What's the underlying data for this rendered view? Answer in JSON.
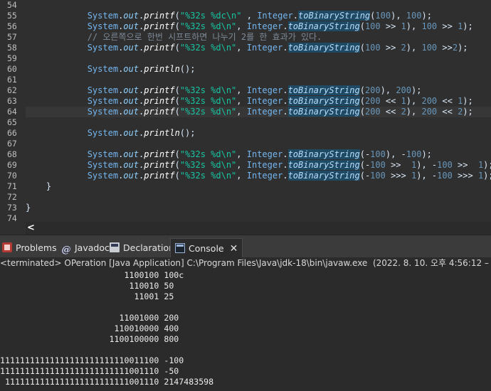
{
  "editor": {
    "current_line": 64,
    "lines": [
      {
        "num": "54",
        "tokens": []
      },
      {
        "num": "55",
        "tokens": [
          {
            "t": "System",
            "c": "cls"
          },
          {
            "t": ".",
            "c": "pln"
          },
          {
            "t": "out",
            "c": "fld"
          },
          {
            "t": ".",
            "c": "pln"
          },
          {
            "t": "printf",
            "c": "mth"
          },
          {
            "t": "(",
            "c": "pln"
          },
          {
            "t": "\"%32s %dc\\n\"",
            "c": "str"
          },
          {
            "t": " , ",
            "c": "pln"
          },
          {
            "t": "Integer",
            "c": "cls"
          },
          {
            "t": ".",
            "c": "pln"
          },
          {
            "t": "toBinaryString",
            "c": "hl"
          },
          {
            "t": "(",
            "c": "pln"
          },
          {
            "t": "100",
            "c": "num"
          },
          {
            "t": "), ",
            "c": "pln"
          },
          {
            "t": "100",
            "c": "num"
          },
          {
            "t": ");",
            "c": "pln"
          }
        ]
      },
      {
        "num": "56",
        "tokens": [
          {
            "t": "System",
            "c": "cls"
          },
          {
            "t": ".",
            "c": "pln"
          },
          {
            "t": "out",
            "c": "fld"
          },
          {
            "t": ".",
            "c": "pln"
          },
          {
            "t": "printf",
            "c": "mth"
          },
          {
            "t": "(",
            "c": "pln"
          },
          {
            "t": "\"%32s %d\\n\"",
            "c": "str"
          },
          {
            "t": ", ",
            "c": "pln"
          },
          {
            "t": "Integer",
            "c": "cls"
          },
          {
            "t": ".",
            "c": "pln"
          },
          {
            "t": "toBinaryString",
            "c": "hl"
          },
          {
            "t": "(",
            "c": "pln"
          },
          {
            "t": "100",
            "c": "num"
          },
          {
            "t": " >> ",
            "c": "pln"
          },
          {
            "t": "1",
            "c": "num"
          },
          {
            "t": "), ",
            "c": "pln"
          },
          {
            "t": "100",
            "c": "num"
          },
          {
            "t": " >> ",
            "c": "pln"
          },
          {
            "t": "1",
            "c": "num"
          },
          {
            "t": ");",
            "c": "pln"
          }
        ]
      },
      {
        "num": "57",
        "tokens": [
          {
            "t": "// 오른쪽으로 한번 시프트하면 나누기 2를 한 효과가 있다.",
            "c": "cmt"
          }
        ]
      },
      {
        "num": "58",
        "tokens": [
          {
            "t": "System",
            "c": "cls"
          },
          {
            "t": ".",
            "c": "pln"
          },
          {
            "t": "out",
            "c": "fld"
          },
          {
            "t": ".",
            "c": "pln"
          },
          {
            "t": "printf",
            "c": "mth"
          },
          {
            "t": "(",
            "c": "pln"
          },
          {
            "t": "\"%32s %d\\n\"",
            "c": "str"
          },
          {
            "t": ", ",
            "c": "pln"
          },
          {
            "t": "Integer",
            "c": "cls"
          },
          {
            "t": ".",
            "c": "pln"
          },
          {
            "t": "toBinaryString",
            "c": "hl"
          },
          {
            "t": "(",
            "c": "pln"
          },
          {
            "t": "100",
            "c": "num"
          },
          {
            "t": " >> ",
            "c": "pln"
          },
          {
            "t": "2",
            "c": "num"
          },
          {
            "t": "), ",
            "c": "pln"
          },
          {
            "t": "100",
            "c": "num"
          },
          {
            "t": " >>",
            "c": "pln"
          },
          {
            "t": "2",
            "c": "num"
          },
          {
            "t": ");",
            "c": "pln"
          }
        ]
      },
      {
        "num": "59",
        "tokens": []
      },
      {
        "num": "60",
        "tokens": [
          {
            "t": "System",
            "c": "cls"
          },
          {
            "t": ".",
            "c": "pln"
          },
          {
            "t": "out",
            "c": "fld"
          },
          {
            "t": ".",
            "c": "pln"
          },
          {
            "t": "println",
            "c": "mth"
          },
          {
            "t": "();",
            "c": "pln"
          }
        ]
      },
      {
        "num": "61",
        "tokens": []
      },
      {
        "num": "62",
        "tokens": [
          {
            "t": "System",
            "c": "cls"
          },
          {
            "t": ".",
            "c": "pln"
          },
          {
            "t": "out",
            "c": "fld"
          },
          {
            "t": ".",
            "c": "pln"
          },
          {
            "t": "printf",
            "c": "mth"
          },
          {
            "t": "(",
            "c": "pln"
          },
          {
            "t": "\"%32s %d\\n\"",
            "c": "str"
          },
          {
            "t": ", ",
            "c": "pln"
          },
          {
            "t": "Integer",
            "c": "cls"
          },
          {
            "t": ".",
            "c": "pln"
          },
          {
            "t": "toBinaryString",
            "c": "hl"
          },
          {
            "t": "(",
            "c": "pln"
          },
          {
            "t": "200",
            "c": "num"
          },
          {
            "t": "), ",
            "c": "pln"
          },
          {
            "t": "200",
            "c": "num"
          },
          {
            "t": ");",
            "c": "pln"
          }
        ]
      },
      {
        "num": "63",
        "tokens": [
          {
            "t": "System",
            "c": "cls"
          },
          {
            "t": ".",
            "c": "pln"
          },
          {
            "t": "out",
            "c": "fld"
          },
          {
            "t": ".",
            "c": "pln"
          },
          {
            "t": "printf",
            "c": "mth"
          },
          {
            "t": "(",
            "c": "pln"
          },
          {
            "t": "\"%32s %d\\n\"",
            "c": "str"
          },
          {
            "t": ", ",
            "c": "pln"
          },
          {
            "t": "Integer",
            "c": "cls"
          },
          {
            "t": ".",
            "c": "pln"
          },
          {
            "t": "toBinaryString",
            "c": "hl"
          },
          {
            "t": "(",
            "c": "pln"
          },
          {
            "t": "200",
            "c": "num"
          },
          {
            "t": " << ",
            "c": "pln"
          },
          {
            "t": "1",
            "c": "num"
          },
          {
            "t": "), ",
            "c": "pln"
          },
          {
            "t": "200",
            "c": "num"
          },
          {
            "t": " << ",
            "c": "pln"
          },
          {
            "t": "1",
            "c": "num"
          },
          {
            "t": ");",
            "c": "pln"
          }
        ]
      },
      {
        "num": "64",
        "tokens": [
          {
            "t": "System",
            "c": "cls"
          },
          {
            "t": ".",
            "c": "pln"
          },
          {
            "t": "out",
            "c": "fld"
          },
          {
            "t": ".",
            "c": "pln"
          },
          {
            "t": "printf",
            "c": "mth"
          },
          {
            "t": "(",
            "c": "pln"
          },
          {
            "t": "\"%32s %d\\n\"",
            "c": "str"
          },
          {
            "t": ", ",
            "c": "pln"
          },
          {
            "t": "Integer",
            "c": "cls"
          },
          {
            "t": ".",
            "c": "pln"
          },
          {
            "t": "toBinaryStr",
            "c": "hl"
          },
          {
            "t": "|",
            "c": "caret"
          },
          {
            "t": "ing",
            "c": "hl"
          },
          {
            "t": "(",
            "c": "pln"
          },
          {
            "t": "200",
            "c": "num"
          },
          {
            "t": " << ",
            "c": "pln"
          },
          {
            "t": "2",
            "c": "num"
          },
          {
            "t": "), ",
            "c": "pln"
          },
          {
            "t": "200",
            "c": "num"
          },
          {
            "t": " << ",
            "c": "pln"
          },
          {
            "t": "2",
            "c": "num"
          },
          {
            "t": ");",
            "c": "pln"
          }
        ]
      },
      {
        "num": "65",
        "tokens": []
      },
      {
        "num": "66",
        "tokens": [
          {
            "t": "System",
            "c": "cls"
          },
          {
            "t": ".",
            "c": "pln"
          },
          {
            "t": "out",
            "c": "fld"
          },
          {
            "t": ".",
            "c": "pln"
          },
          {
            "t": "println",
            "c": "mth"
          },
          {
            "t": "();",
            "c": "pln"
          }
        ]
      },
      {
        "num": "67",
        "tokens": []
      },
      {
        "num": "68",
        "tokens": [
          {
            "t": "System",
            "c": "cls"
          },
          {
            "t": ".",
            "c": "pln"
          },
          {
            "t": "out",
            "c": "fld"
          },
          {
            "t": ".",
            "c": "pln"
          },
          {
            "t": "printf",
            "c": "mth"
          },
          {
            "t": "(",
            "c": "pln"
          },
          {
            "t": "\"%32s %d\\n\"",
            "c": "str"
          },
          {
            "t": ", ",
            "c": "pln"
          },
          {
            "t": "Integer",
            "c": "cls"
          },
          {
            "t": ".",
            "c": "pln"
          },
          {
            "t": "toBinaryString",
            "c": "hl"
          },
          {
            "t": "(-",
            "c": "pln"
          },
          {
            "t": "100",
            "c": "num"
          },
          {
            "t": "), -",
            "c": "pln"
          },
          {
            "t": "100",
            "c": "num"
          },
          {
            "t": ");",
            "c": "pln"
          }
        ]
      },
      {
        "num": "69",
        "tokens": [
          {
            "t": "System",
            "c": "cls"
          },
          {
            "t": ".",
            "c": "pln"
          },
          {
            "t": "out",
            "c": "fld"
          },
          {
            "t": ".",
            "c": "pln"
          },
          {
            "t": "printf",
            "c": "mth"
          },
          {
            "t": "(",
            "c": "pln"
          },
          {
            "t": "\"%32s %d\\n\"",
            "c": "str"
          },
          {
            "t": ", ",
            "c": "pln"
          },
          {
            "t": "Integer",
            "c": "cls"
          },
          {
            "t": ".",
            "c": "pln"
          },
          {
            "t": "toBinaryString",
            "c": "hl"
          },
          {
            "t": "(-",
            "c": "pln"
          },
          {
            "t": "100",
            "c": "num"
          },
          {
            "t": " >>  ",
            "c": "pln"
          },
          {
            "t": "1",
            "c": "num"
          },
          {
            "t": "), -",
            "c": "pln"
          },
          {
            "t": "100",
            "c": "num"
          },
          {
            "t": " >>  ",
            "c": "pln"
          },
          {
            "t": "1",
            "c": "num"
          },
          {
            "t": ");",
            "c": "pln"
          }
        ]
      },
      {
        "num": "70",
        "tokens": [
          {
            "t": "System",
            "c": "cls"
          },
          {
            "t": ".",
            "c": "pln"
          },
          {
            "t": "out",
            "c": "fld"
          },
          {
            "t": ".",
            "c": "pln"
          },
          {
            "t": "printf",
            "c": "mth"
          },
          {
            "t": "(",
            "c": "pln"
          },
          {
            "t": "\"%32s %d\\n\"",
            "c": "str"
          },
          {
            "t": ", ",
            "c": "pln"
          },
          {
            "t": "Integer",
            "c": "cls"
          },
          {
            "t": ".",
            "c": "pln"
          },
          {
            "t": "toBinaryString",
            "c": "hl"
          },
          {
            "t": "(-",
            "c": "pln"
          },
          {
            "t": "100",
            "c": "num"
          },
          {
            "t": " >>> ",
            "c": "pln"
          },
          {
            "t": "1",
            "c": "num"
          },
          {
            "t": "), -",
            "c": "pln"
          },
          {
            "t": "100",
            "c": "num"
          },
          {
            "t": " >>> ",
            "c": "pln"
          },
          {
            "t": "1",
            "c": "num"
          },
          {
            "t": ");",
            "c": "pln"
          }
        ]
      },
      {
        "num": "71",
        "tokens": [
          {
            "t": "}",
            "c": "pln"
          }
        ]
      },
      {
        "num": "72",
        "tokens": []
      },
      {
        "num": "73",
        "tokens": [
          {
            "t": "}",
            "c": "pln"
          }
        ]
      },
      {
        "num": "74",
        "tokens": []
      }
    ]
  },
  "scrollbar": {
    "left_arrow": "<"
  },
  "tabs": [
    {
      "label": "Problems",
      "icon": "problems-icon",
      "active": false
    },
    {
      "label": "Javadoc",
      "icon": "javadoc-icon",
      "active": false
    },
    {
      "label": "Declaration",
      "icon": "declaration-icon",
      "active": false
    },
    {
      "label": "Console",
      "icon": "console-icon",
      "active": true,
      "close": "✕"
    }
  ],
  "console": {
    "status": "<terminated> OPeration [Java Application] C:\\Program Files\\Java\\jdk-18\\bin\\javaw.exe  (2022. 8. 10. 오후 4:56:12 – 오후 4:",
    "output": [
      "                         1100100 100c",
      "                          110010 50",
      "                           11001 25",
      "",
      "                        11001000 200",
      "                       110010000 400",
      "                      1100100000 800",
      "",
      "11111111111111111111111110011100 -100",
      "11111111111111111111111111001110 -50",
      " 1111111111111111111111111001110 2147483598"
    ]
  },
  "colors": {
    "editor_bg": "#2f2f2f",
    "console_bg": "#2b2b2b",
    "highlight": "#1e4a63",
    "string": "#17c6a3",
    "class": "#73b6f0"
  }
}
